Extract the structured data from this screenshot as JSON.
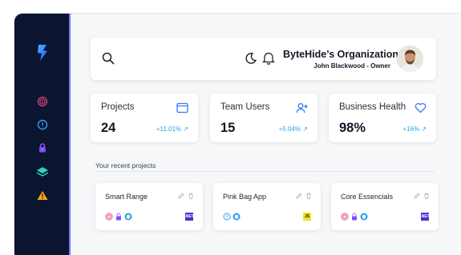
{
  "header": {
    "org_name": "ByteHide’s Organization",
    "owner_line": "John Blackwood - Owner"
  },
  "stats": [
    {
      "title": "Projects",
      "value": "24",
      "change": "+11.01%",
      "icon": "window-icon"
    },
    {
      "title": "Team Users",
      "value": "15",
      "change": "+5.04%",
      "icon": "add-user-icon"
    },
    {
      "title": "Business Health",
      "value": "98%",
      "change": "+16%",
      "icon": "heart-icon"
    }
  ],
  "recent": {
    "title": "Your recent projects",
    "projects": [
      {
        "name": "Smart Range",
        "tech": ".NET",
        "tech_color": "#512bd4"
      },
      {
        "name": "Pink Bag App",
        "tech": "JS",
        "tech_color": "#f7df1e"
      },
      {
        "name": "Core Essencials",
        "tech": ".NET",
        "tech_color": "#512bd4"
      }
    ]
  },
  "sidebar_icons": [
    "fingerprint-icon",
    "shield-lock-icon",
    "lock-icon",
    "layers-icon",
    "warning-icon"
  ],
  "colors": {
    "sidebar": "#0b1530",
    "accent": "#22a4e6",
    "brand": "#2f6bff"
  }
}
